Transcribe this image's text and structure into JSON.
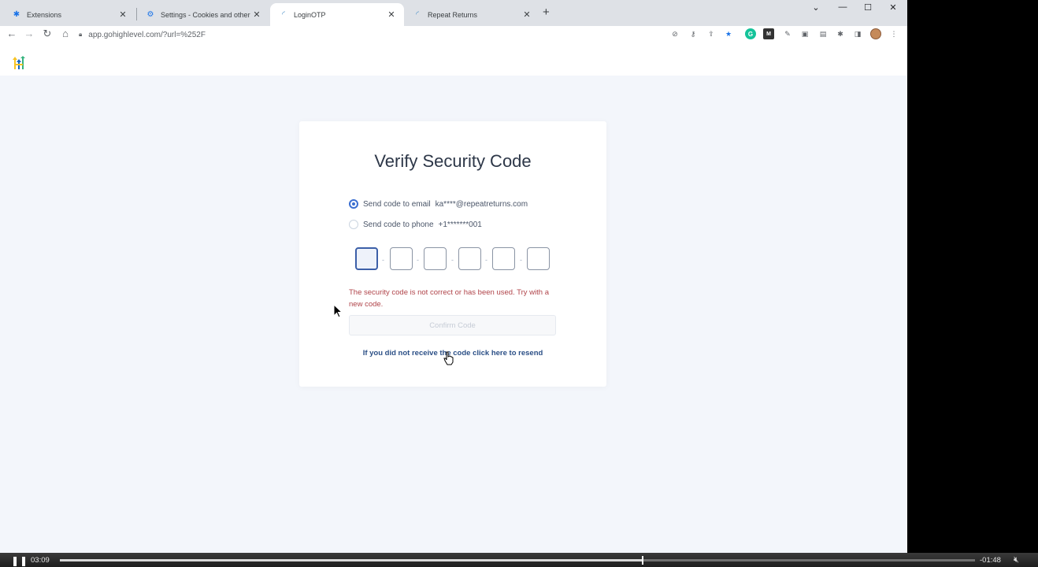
{
  "browser": {
    "tabs": [
      {
        "title": "Extensions",
        "icon": "puzzle-icon"
      },
      {
        "title": "Settings - Cookies and other site",
        "icon": "gear-icon"
      },
      {
        "title": "LoginOTP",
        "icon": "loading-icon"
      },
      {
        "title": "Repeat Returns",
        "icon": "loading-icon"
      }
    ],
    "active_tab": 2,
    "new_tab_label": "+",
    "url": "app.gohighlevel.com/?url=%252F"
  },
  "verify": {
    "title": "Verify Security Code",
    "options": [
      {
        "label": "Send code to email",
        "value": "ka****@repeatreturns.com",
        "checked": true
      },
      {
        "label": "Send code to phone",
        "value": "+1*******001",
        "checked": false
      }
    ],
    "code_digits": [
      "",
      "",
      "",
      "",
      "",
      ""
    ],
    "error": "The security code is not correct or has been used. Try with a new code.",
    "confirm_label": "Confirm Code",
    "resend_label": "If you did not receive the code click here to resend"
  },
  "video": {
    "elapsed": "03:09",
    "remaining": "-01:48",
    "progress": 0.637
  },
  "colors": {
    "accent": "#3c6fd1",
    "error": "#b0444a",
    "link": "#2b4f86",
    "page_bg": "#f3f6fb"
  }
}
